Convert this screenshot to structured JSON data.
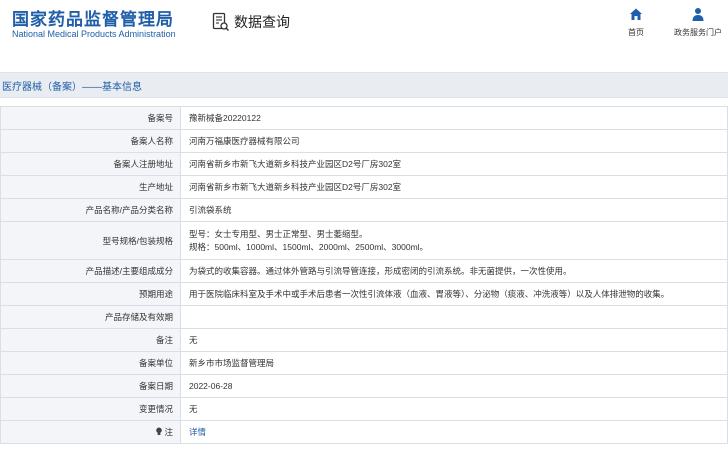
{
  "header": {
    "logo_cn": "国家药品监督管理局",
    "logo_en": "National Medical Products Administration",
    "app_title": "数据查询",
    "nav": {
      "home": "首页",
      "service": "政务服务门户"
    }
  },
  "section": {
    "title": "医疗器械（备案）——基本信息"
  },
  "rows": [
    {
      "label": "备案号",
      "lines": [
        "豫新械备20220122"
      ]
    },
    {
      "label": "备案人名称",
      "lines": [
        "河南万福康医疗器械有限公司"
      ]
    },
    {
      "label": "备案人注册地址",
      "lines": [
        "河南省新乡市新飞大道新乡科技产业园区D2号厂房302室"
      ]
    },
    {
      "label": "生产地址",
      "lines": [
        "河南省新乡市新飞大道新乡科技产业园区D2号厂房302室"
      ]
    },
    {
      "label": "产品名称/产品分类名称",
      "lines": [
        "引流袋系统"
      ]
    },
    {
      "label": "型号规格/包装规格",
      "lines": [
        "型号：女士专用型、男士正常型、男士萎缩型。",
        "规格：500ml、1000ml、1500ml、2000ml、2500ml、3000ml。"
      ]
    },
    {
      "label": "产品描述/主要组成成分",
      "lines": [
        "为袋式的收集容器。通过体外管路与引流导管连接，形成密闭的引流系统。非无菌提供，一次性使用。"
      ]
    },
    {
      "label": "预期用途",
      "lines": [
        "用于医院临床科室及手术中或手术后患者一次性引流体液（血液、胃液等）、分泌物（痰液、冲洗液等）以及人体排泄物的收集。"
      ]
    },
    {
      "label": "产品存储及有效期",
      "lines": [
        ""
      ]
    },
    {
      "label": "备注",
      "lines": [
        "无"
      ]
    },
    {
      "label": "备案单位",
      "lines": [
        "新乡市市场监督管理局"
      ]
    },
    {
      "label": "备案日期",
      "lines": [
        "2022-06-28"
      ]
    },
    {
      "label": "变更情况",
      "lines": [
        "无"
      ]
    },
    {
      "label": "注",
      "lines": [
        "详情"
      ],
      "link": true
    }
  ],
  "colors": {
    "brand": "#1f5ea8",
    "section_bg": "#e9edf2",
    "label_bg": "#f3f5f8",
    "border": "#d9dfe6"
  },
  "icons": {
    "app_title": "document-search-icon",
    "home": "home-icon",
    "service": "person-icon",
    "note": "lightbulb-icon"
  }
}
